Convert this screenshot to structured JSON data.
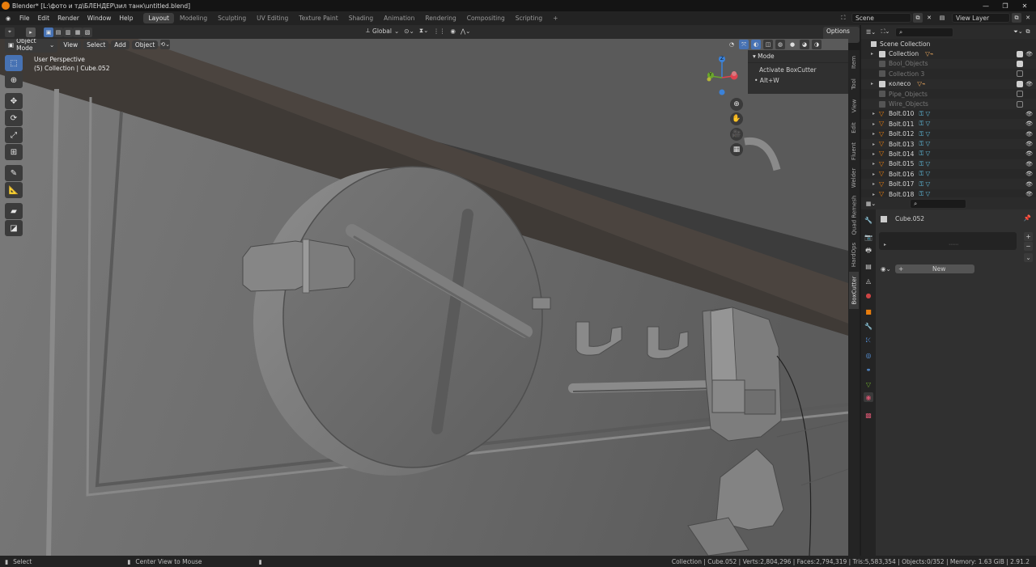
{
  "title": "Blender* [L:\\фото и тд\\БЛЕНДЕР\\зил танк\\untitled.blend]",
  "menu": [
    "File",
    "Edit",
    "Render",
    "Window",
    "Help"
  ],
  "workspaces": [
    "Layout",
    "Modeling",
    "Sculpting",
    "UV Editing",
    "Texture Paint",
    "Shading",
    "Animation",
    "Rendering",
    "Compositing",
    "Scripting"
  ],
  "scene": {
    "name": "Scene",
    "view_layer": "View Layer"
  },
  "viewport": {
    "mode": "Object Mode",
    "menus": [
      "View",
      "Select",
      "Add",
      "Object"
    ],
    "orientation": "Global",
    "options": "Options",
    "perspective": "User Perspective",
    "collection_info": "(5) Collection | Cube.052"
  },
  "gizmo": {
    "z": "Z",
    "y": "Y"
  },
  "npanel": {
    "title": "Mode",
    "item": "Activate BoxCutter",
    "shortcut": "• Alt+W"
  },
  "side_tabs": [
    "Item",
    "Tool",
    "View",
    "Edit",
    "Fluent",
    "Welder",
    "Quad Remesh",
    "HardOps",
    "BoxCutter"
  ],
  "outliner": {
    "root": "Scene Collection",
    "rows": [
      {
        "name": "Collection",
        "kind": "collection",
        "checked": true,
        "dim": false
      },
      {
        "name": "Bool_Objects",
        "kind": "collection",
        "checked": true,
        "dim": true
      },
      {
        "name": "Collection 3",
        "kind": "collection",
        "checked": false,
        "dim": true
      },
      {
        "name": "колесо",
        "kind": "collection",
        "checked": true,
        "dim": false
      },
      {
        "name": "Pipe_Objects",
        "kind": "collection",
        "checked": false,
        "dim": true
      },
      {
        "name": "Wire_Objects",
        "kind": "collection",
        "checked": false,
        "dim": true
      },
      {
        "name": "Bolt.010",
        "kind": "object"
      },
      {
        "name": "Bolt.011",
        "kind": "object"
      },
      {
        "name": "Bolt.012",
        "kind": "object"
      },
      {
        "name": "Bolt.013",
        "kind": "object"
      },
      {
        "name": "Bolt.014",
        "kind": "object"
      },
      {
        "name": "Bolt.015",
        "kind": "object"
      },
      {
        "name": "Bolt.016",
        "kind": "object"
      },
      {
        "name": "Bolt.017",
        "kind": "object"
      },
      {
        "name": "Bolt.018",
        "kind": "object"
      }
    ]
  },
  "properties": {
    "object": "Cube.052",
    "new_button": "New"
  },
  "status": {
    "left": "Select",
    "center": "Center View to Mouse",
    "stats": "Collection | Cube.052 | Verts:2,804,296 | Faces:2,794,319 | Tris:5,583,354 | Objects:0/352 | Memory: 1.63 GiB | 2.91.2"
  },
  "colors": {
    "accent": "#4772b3",
    "brand": "#e87d0d",
    "x_axis": "#e0424f",
    "y_axis": "#6ba72d",
    "z_axis": "#3b82d9"
  }
}
